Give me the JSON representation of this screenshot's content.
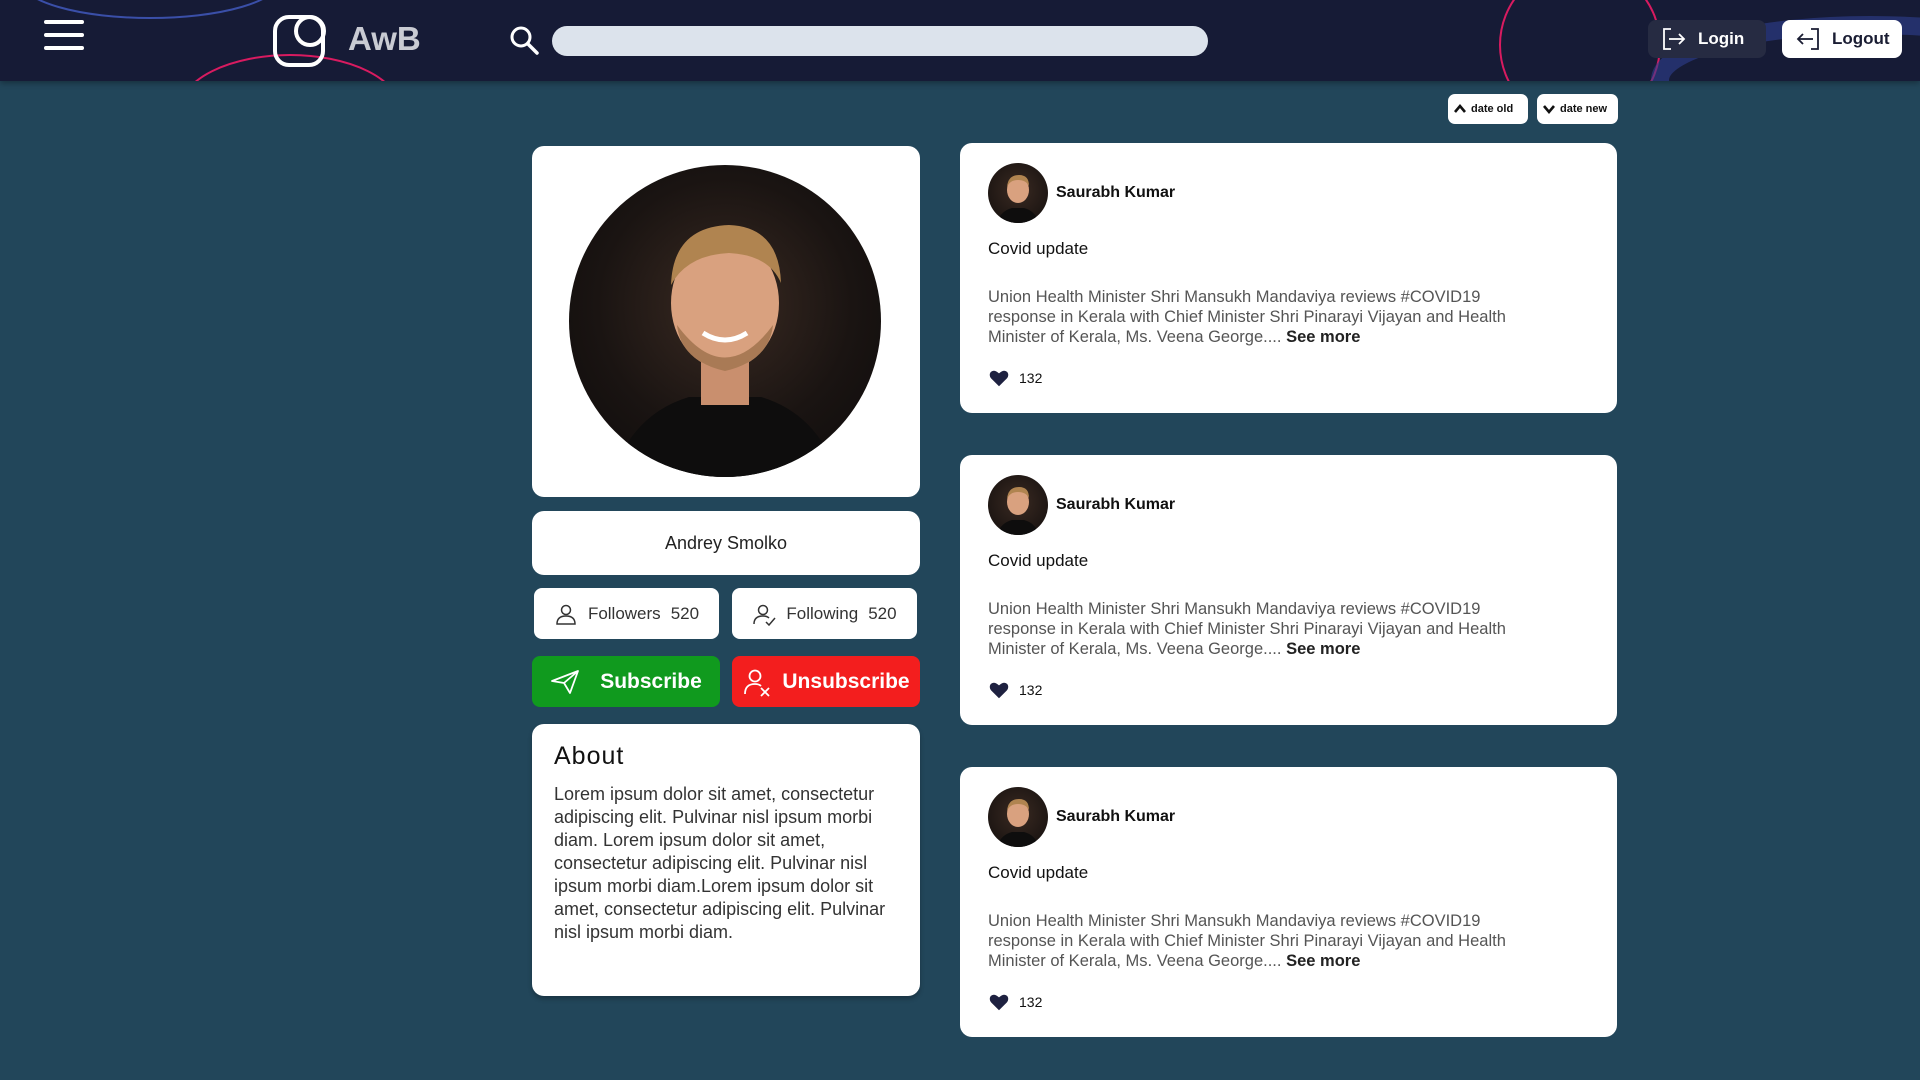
{
  "header": {
    "brand": "AwB",
    "search": {
      "value": "",
      "placeholder": ""
    },
    "login_label": "Login",
    "logout_label": "Logout"
  },
  "sort": {
    "old_label": "date old",
    "new_label": "date new"
  },
  "profile": {
    "name": "Andrey Smolko",
    "followers_label": "Followers",
    "followers_count": "520",
    "following_label": "Following",
    "following_count": "520",
    "subscribe_label": "Subscribe",
    "unsubscribe_label": "Unsubscribe",
    "about_title": "About",
    "about_text": "Lorem ipsum dolor sit amet, consectetur adipiscing elit. Pulvinar nisl ipsum morbi diam. Lorem ipsum dolor sit amet, consectetur adipiscing elit. Pulvinar nisl ipsum morbi diam.Lorem ipsum dolor sit amet, consectetur adipiscing elit. Pulvinar nisl ipsum morbi diam."
  },
  "posts": [
    {
      "author": "Saurabh Kumar",
      "title": "Covid update",
      "text": "Union Health Minister Shri Mansukh Mandaviya reviews #COVID19 response in Kerala with Chief Minister Shri Pinarayi Vijayan and Health Minister of Kerala, Ms. Veena George....",
      "see_more": "See more",
      "likes": "132"
    },
    {
      "author": "Saurabh Kumar",
      "title": "Covid update",
      "text": "Union Health Minister Shri Mansukh Mandaviya reviews #COVID19 response in Kerala with Chief Minister Shri Pinarayi Vijayan and Health Minister of Kerala, Ms. Veena George....",
      "see_more": "See more",
      "likes": "132"
    },
    {
      "author": "Saurabh Kumar",
      "title": "Covid update",
      "text": "Union Health Minister Shri Mansukh Mandaviya reviews #COVID19 response in Kerala with Chief Minister Shri Pinarayi Vijayan and Health Minister of Kerala, Ms. Veena George....",
      "see_more": "See more",
      "likes": "132"
    }
  ],
  "colors": {
    "background": "#22465a",
    "header": "#161b36",
    "subscribe": "#109a1e",
    "unsubscribe": "#f31e1e",
    "deco_pink": "#d81b60",
    "deco_blue": "#3a4fa8"
  },
  "icons": {
    "menu": "hamburger-icon",
    "logo": "logo-icon",
    "search": "search-icon",
    "login": "login-icon",
    "logout": "logout-icon",
    "sort_old": "chevron-up-icon",
    "sort_new": "chevron-down-icon",
    "followers": "user-icon",
    "following": "user-check-icon",
    "subscribe": "send-icon",
    "unsubscribe": "user-remove-icon",
    "like": "heart-icon"
  }
}
